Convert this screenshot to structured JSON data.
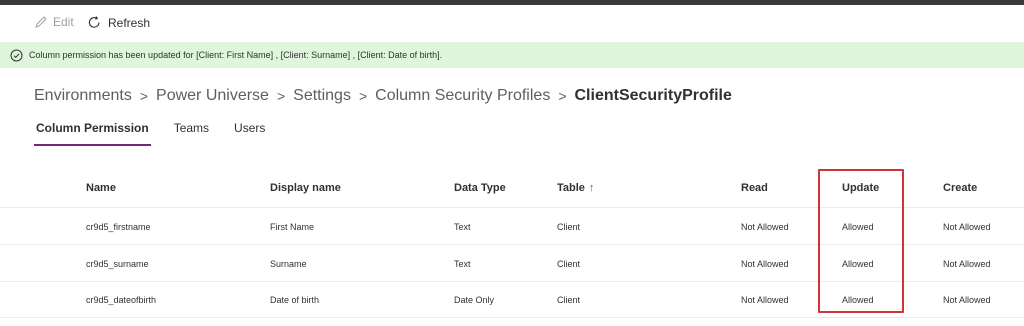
{
  "toolbar": {
    "edit_label": "Edit",
    "refresh_label": "Refresh"
  },
  "notification": {
    "text": "Column permission has been updated for [Client: First Name] , [Client: Surname] , [Client: Date of birth].",
    "icon": "success-check-icon",
    "color": "#dff6dd"
  },
  "breadcrumb": {
    "items": [
      "Environments",
      "Power Universe",
      "Settings",
      "Column Security Profiles"
    ],
    "current": "ClientSecurityProfile",
    "separator": ">"
  },
  "tabs": [
    {
      "label": "Column Permission",
      "active": true
    },
    {
      "label": "Teams",
      "active": false
    },
    {
      "label": "Users",
      "active": false
    }
  ],
  "table": {
    "columns": [
      "Name",
      "Display name",
      "Data Type",
      "Table",
      "Read",
      "Update",
      "Create"
    ],
    "sort_indicator": "↑",
    "rows": [
      [
        "cr9d5_firstname",
        "First Name",
        "Text",
        "Client",
        "Not Allowed",
        "Allowed",
        "Not Allowed"
      ],
      [
        "cr9d5_surname",
        "Surname",
        "Text",
        "Client",
        "Not Allowed",
        "Allowed",
        "Not Allowed"
      ],
      [
        "cr9d5_dateofbirth",
        "Date of birth",
        "Date Only",
        "Client",
        "Not Allowed",
        "Allowed",
        "Not Allowed"
      ]
    ]
  },
  "colors": {
    "accent": "#742774",
    "highlight": "#d13438",
    "sort_arrow": "#0078d4"
  }
}
